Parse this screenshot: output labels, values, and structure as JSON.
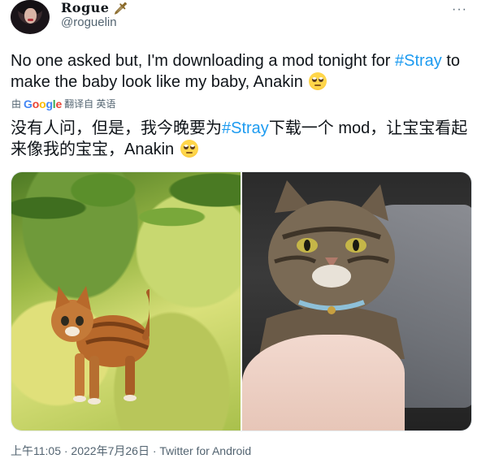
{
  "author": {
    "display_name": "Rogue",
    "name_icon": "sword-icon",
    "handle": "@roguelin"
  },
  "tweet": {
    "text_before_hashtag": "No one asked but, I'm downloading a mod tonight for ",
    "hashtag": "#Stray",
    "text_after_hashtag": " to make the baby look like my baby, Anakin",
    "emoji": "face-with-rolling-eyes"
  },
  "translation": {
    "prefix": "由",
    "provider": "Google",
    "suffix": "翻译自 英语",
    "text_before_hashtag": "没有人问，但是，我今晚要为",
    "hashtag": "#Stray",
    "text_after_hashtag": "下载一个 mod，让宝宝看起来像我的宝宝，Anakin"
  },
  "media": [
    {
      "alt": "game-cat-photo"
    },
    {
      "alt": "real-cat-photo"
    }
  ],
  "meta": {
    "timestamp": "上午11:05 · 2022年7月26日 · Twitter for Android"
  },
  "colors": {
    "accent": "#1d9bf0",
    "text": "#0f1419",
    "secondary": "#536471"
  }
}
